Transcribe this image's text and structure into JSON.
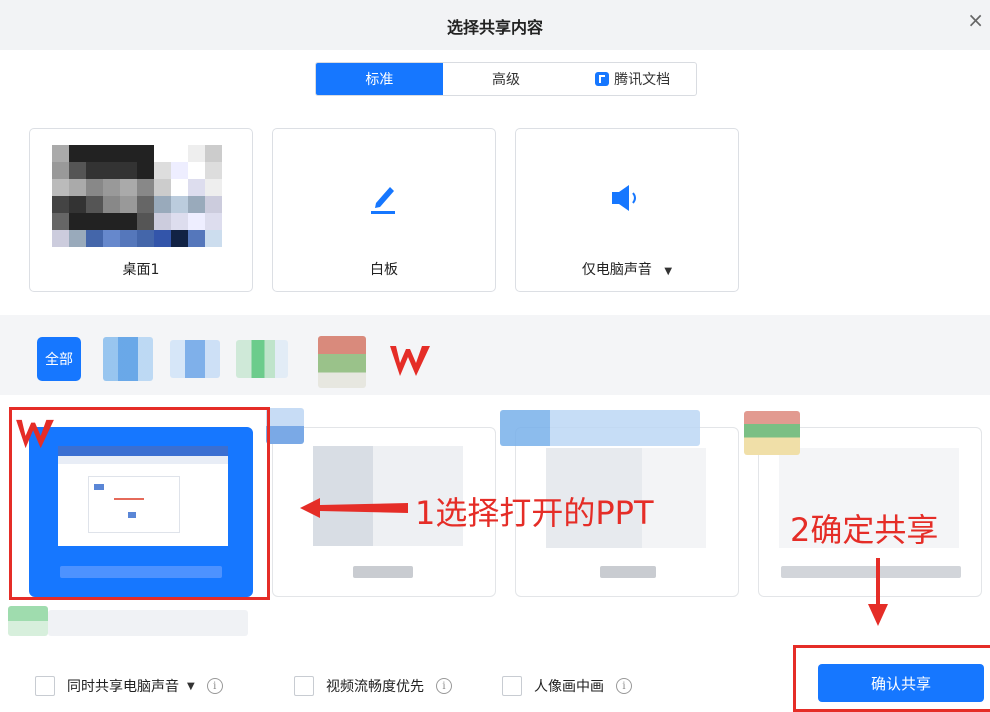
{
  "dialog": {
    "title": "选择共享内容",
    "close_symbol": "×"
  },
  "tabs": [
    {
      "label": "标准",
      "active": true
    },
    {
      "label": "高级",
      "active": false
    },
    {
      "label": "腾讯文档",
      "active": false,
      "icon": "tencent-docs-icon"
    }
  ],
  "cards": [
    {
      "label": "桌面1",
      "icon": "desktop-thumbnail"
    },
    {
      "label": "白板",
      "icon": "pen-icon"
    },
    {
      "label": "仅电脑声音",
      "icon": "speaker-icon",
      "dropdown": "▼"
    }
  ],
  "filters": {
    "all_label": "全部"
  },
  "annotations": {
    "step1": "1选择打开的PPT",
    "step2": "2确定共享"
  },
  "options": [
    {
      "label": "同时共享电脑声音",
      "checked": false,
      "dropdown": "▼",
      "info": "i"
    },
    {
      "label": "视频流畅度优先",
      "checked": false,
      "info": "i"
    },
    {
      "label": "人像画中画",
      "checked": false,
      "info": "i"
    }
  ],
  "confirm_button": "确认共享",
  "colors": {
    "accent": "#1677ff",
    "annotation": "#e52d27"
  }
}
